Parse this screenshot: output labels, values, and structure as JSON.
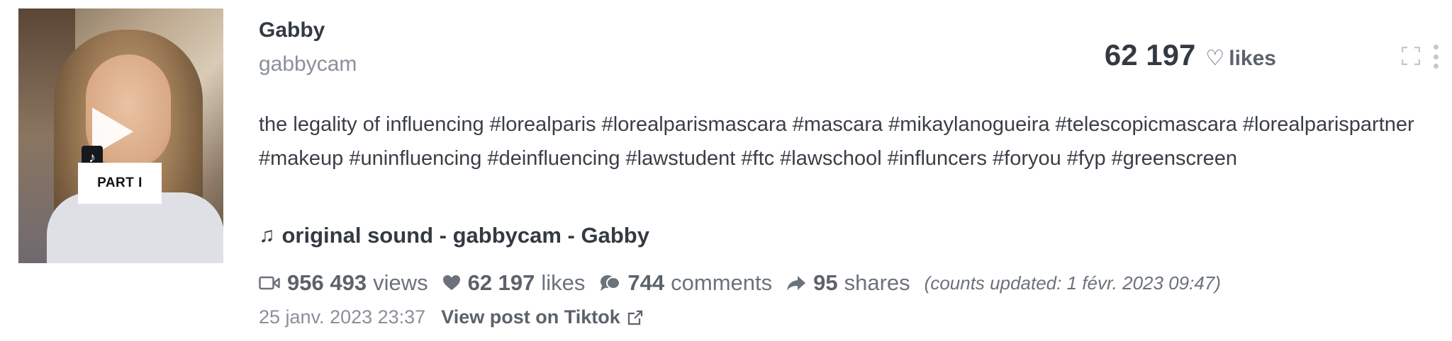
{
  "thumbnail": {
    "overlay_text": "PART I",
    "badge_icon": "tiktok-icon"
  },
  "author": {
    "name": "Gabby",
    "handle": "gabbycam"
  },
  "likes_header": {
    "count": "62 197",
    "label": "likes"
  },
  "description": "the legality of influencing #lorealparis #lorealparismascara #mascara #mikaylanogueira #telescopicmascara #lorealparispartner #makeup #uninfluencing #deinfluencing #lawstudent #ftc #lawschool #influncers #foryou #fyp #greenscreen",
  "sound": {
    "title": "original sound - gabbycam - Gabby"
  },
  "stats": {
    "views": {
      "count": "956 493",
      "label": "views"
    },
    "likes": {
      "count": "62 197",
      "label": "likes"
    },
    "comments": {
      "count": "744",
      "label": "comments"
    },
    "shares": {
      "count": "95",
      "label": "shares"
    },
    "updated_prefix": "(counts updated:",
    "updated_time": "1 févr. 2023 09:47",
    "updated_suffix": ")"
  },
  "post": {
    "date": "25 janv. 2023 23:37",
    "link_label": "View post on Tiktok"
  },
  "colors": {
    "text": "#3a3f47",
    "muted": "#8a9099",
    "accent": "#5c626b"
  }
}
